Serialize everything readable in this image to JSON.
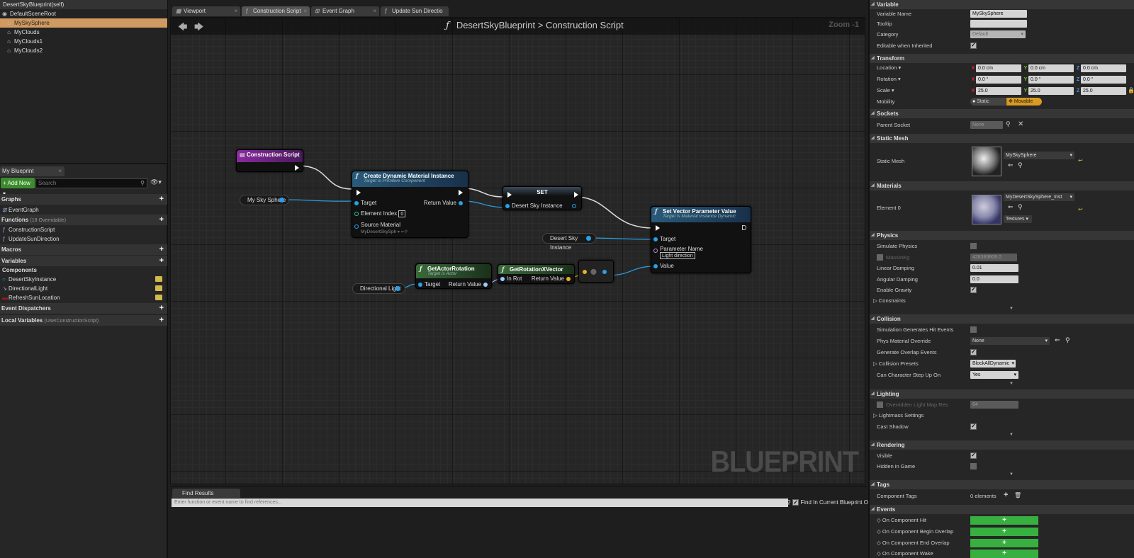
{
  "left": {
    "tree": {
      "root": "DesertSkyBlueprint(self)",
      "items": [
        "DefaultSceneRoot",
        "MySkySphere",
        "MyClouds",
        "MyClouds1",
        "MyClouds2"
      ]
    },
    "tab": "My Blueprint",
    "add_new": "Add New",
    "search_placeholder": "Search",
    "sections": {
      "graphs": "Graphs",
      "functions": "Functions",
      "functions_sub": "(18 Overridable)",
      "macros": "Macros",
      "variables": "Variables",
      "components": "Components",
      "dispatchers": "Event Dispatchers",
      "locals": "Local Variables",
      "locals_sub": "(UserConstructionScript)"
    },
    "graph_items": [
      "EventGraph"
    ],
    "function_items": [
      "ConstructionScript",
      "UpdateSunDirection"
    ],
    "variable_items": [
      "DesertSkyInstance",
      "DirectionalLight",
      "RefreshSunLocation"
    ]
  },
  "tabs": [
    "Viewport",
    "Construction Script",
    "Event Graph",
    "Update Sun Directio"
  ],
  "graph": {
    "breadcrumb_root": "DesertSkyBlueprint",
    "breadcrumb_sep": ">",
    "breadcrumb_leaf": "Construction Script",
    "zoom": "Zoom -1",
    "watermark": "BLUEPRINT",
    "nodes": {
      "construction": "Construction Script",
      "mysky": "My Sky Sphere",
      "cdmi": {
        "title": "Create Dynamic Material Instance",
        "sub": "Target is Primitive Component",
        "target": "Target",
        "elem": "Element Index",
        "elem_val": "0",
        "src": "Source Material",
        "src_val": "MyDesertSkySph",
        "ret": "Return Value"
      },
      "set": {
        "title": "SET",
        "pin": "Desert Sky Instance"
      },
      "dsi": "Desert Sky Instance",
      "svpv": {
        "title": "Set Vector Parameter Value",
        "sub": "Target is Material Instance Dynamic",
        "target": "Target",
        "pname": "Parameter Name",
        "pname_val": "Light direction",
        "value": "Value"
      },
      "gar": {
        "title": "GetActorRotation",
        "sub": "Target is Actor",
        "target": "Target",
        "ret": "Return Value"
      },
      "grxv": {
        "title": "GetRotationXVector",
        "inrot": "In Rot",
        "ret": "Return Value"
      },
      "dirlight": "Directional Light"
    }
  },
  "find": {
    "tab": "Find Results",
    "placeholder": "Enter function or event name to find references...",
    "only": "Find In Current Blueprint Only"
  },
  "details": {
    "variable": {
      "header": "Variable",
      "name_label": "Variable Name",
      "name_val": "MySkySphere",
      "tooltip_label": "Tooltip",
      "category_label": "Category",
      "category_val": "Default",
      "editable_label": "Editable when Inherited"
    },
    "transform": {
      "header": "Transform",
      "location": "Location",
      "rotation": "Rotation",
      "scale": "Scale",
      "mobility": "Mobility",
      "loc": [
        "0.0 cm",
        "0.0 cm",
        "0.0 cm"
      ],
      "rot": [
        "0.0 °",
        "0.0 °",
        "0.0 °"
      ],
      "scl": [
        "25.0",
        "25.0",
        "25.0"
      ],
      "static": "Static",
      "movable": "Movable"
    },
    "sockets": {
      "header": "Sockets",
      "parent": "Parent Socket",
      "parent_val": "None"
    },
    "mesh": {
      "header": "Static Mesh",
      "label": "Static Mesh",
      "val": "MySkySphere"
    },
    "materials": {
      "header": "Materials",
      "label": "Element 0",
      "val": "MyDesertSkySphere_Inst",
      "textures": "Textures"
    },
    "physics": {
      "header": "Physics",
      "simulate": "Simulate Physics",
      "mass": "MassInKg",
      "mass_val": "428383808.0",
      "linear": "Linear Damping",
      "linear_val": "0.01",
      "angular": "Angular Damping",
      "angular_val": "0.0",
      "gravity": "Enable Gravity",
      "constraints": "Constraints"
    },
    "collision": {
      "header": "Collision",
      "simhit": "Simulation Generates Hit Events",
      "physmat": "Phys Material Override",
      "physmat_val": "None",
      "overlap": "Generate Overlap Events",
      "presets": "Collision Presets",
      "presets_val": "BlockAllDynamic",
      "step": "Can Character Step Up On",
      "step_val": "Yes"
    },
    "lighting": {
      "header": "Lighting",
      "lightmap": "Overridden Light Map Res",
      "lightmap_val": "64",
      "lightmass": "Lightmass Settings",
      "shadow": "Cast Shadow"
    },
    "rendering": {
      "header": "Rendering",
      "visible": "Visible",
      "hidden": "Hidden in Game"
    },
    "tags": {
      "header": "Tags",
      "comp": "Component Tags",
      "comp_val": "0 elements"
    },
    "events": {
      "header": "Events",
      "items": [
        "On Component Hit",
        "On Component Begin Overlap",
        "On Component End Overlap",
        "On Component Wake"
      ]
    }
  }
}
